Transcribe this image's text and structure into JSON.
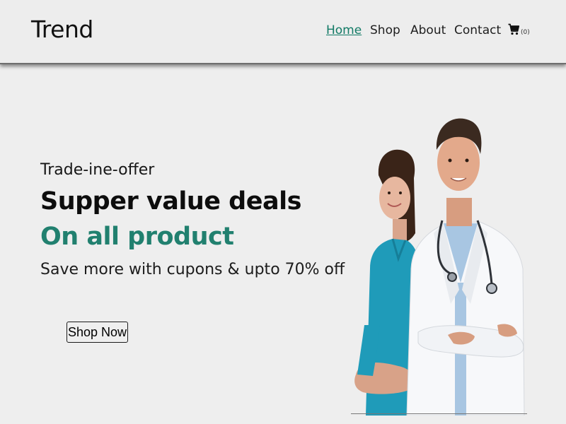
{
  "header": {
    "logo": "Trend",
    "nav": [
      {
        "label": "Home",
        "active": true
      },
      {
        "label": "Shop",
        "active": false
      },
      {
        "label": "About",
        "active": false
      },
      {
        "label": "Contact",
        "active": false
      }
    ],
    "cart": {
      "icon": "cart-icon",
      "count_label": "(0)"
    }
  },
  "hero": {
    "offer_label": "Trade-ine-offer",
    "headline": "Supper value deals",
    "subheadline": "On all product",
    "description": "Save more with cupons & upto 70% off",
    "cta_label": "Shop Now",
    "image": "doctors-photo"
  },
  "colors": {
    "accent": "#21806f",
    "nav_active": "#117a65",
    "background": "#eeeeee"
  }
}
